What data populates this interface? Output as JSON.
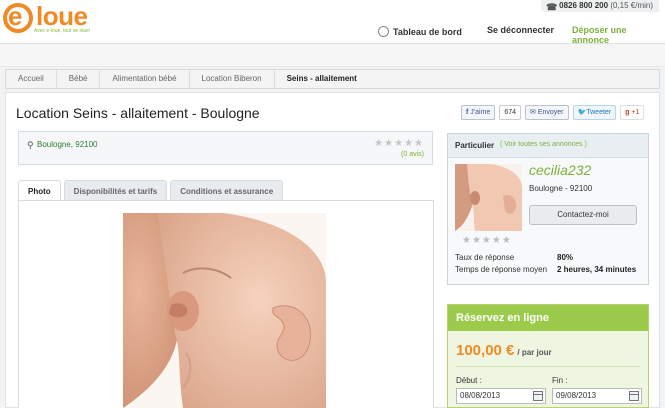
{
  "header": {
    "logo_text": "loue",
    "logo_letter": "e",
    "logo_tagline": "Avec e-loue, tout se loue!",
    "phone_number": "0826 800 200",
    "phone_rate": "(0,15 €/min)",
    "nav": {
      "dashboard": "Tableau de bord",
      "logout": "Se déconnecter",
      "post_ad": "Déposer une annonce"
    }
  },
  "breadcrumb": [
    "Accueil",
    "Bébé",
    "Alimentation bébé",
    "Location Biberon",
    "Seins - allaitement"
  ],
  "listing": {
    "title": "Location Seins - allaitement - Boulogne",
    "location": "Boulogne, 92100",
    "rating_stars": "★★★★★",
    "rating_count": "(0 avis)"
  },
  "social": {
    "like": "J'aime",
    "like_count": "674",
    "send": "Envoyer",
    "tweet": "Tweeter",
    "gplus": "+1"
  },
  "tabs": [
    {
      "label": "Photo",
      "active": true
    },
    {
      "label": "Disponibilités et tarifs",
      "active": false
    },
    {
      "label": "Conditions et assurance",
      "active": false
    }
  ],
  "owner": {
    "type": "Particulier",
    "all_ads_link": "( Voir toutes ses annonces )",
    "username": "cecilia232",
    "city": "Boulogne - 92100",
    "contact_button": "Contactez-moi",
    "stars": "★★★★★",
    "response_rate_label": "Taux de réponse",
    "response_rate_value": "80%",
    "response_time_label": "Temps de réponse moyen",
    "response_time_value": "2 heures, 34 minutes"
  },
  "booking": {
    "title": "Réservez en ligne",
    "price": "100,00 €",
    "per": "/ par jour",
    "start_label": "Début :",
    "start_value": "08/08/2013",
    "end_label": "Fin :",
    "end_value": "09/08/2013"
  },
  "colors": {
    "brand_orange": "#f08a24",
    "brand_green": "#7cb13b",
    "booking_header": "#9ccb4b"
  }
}
